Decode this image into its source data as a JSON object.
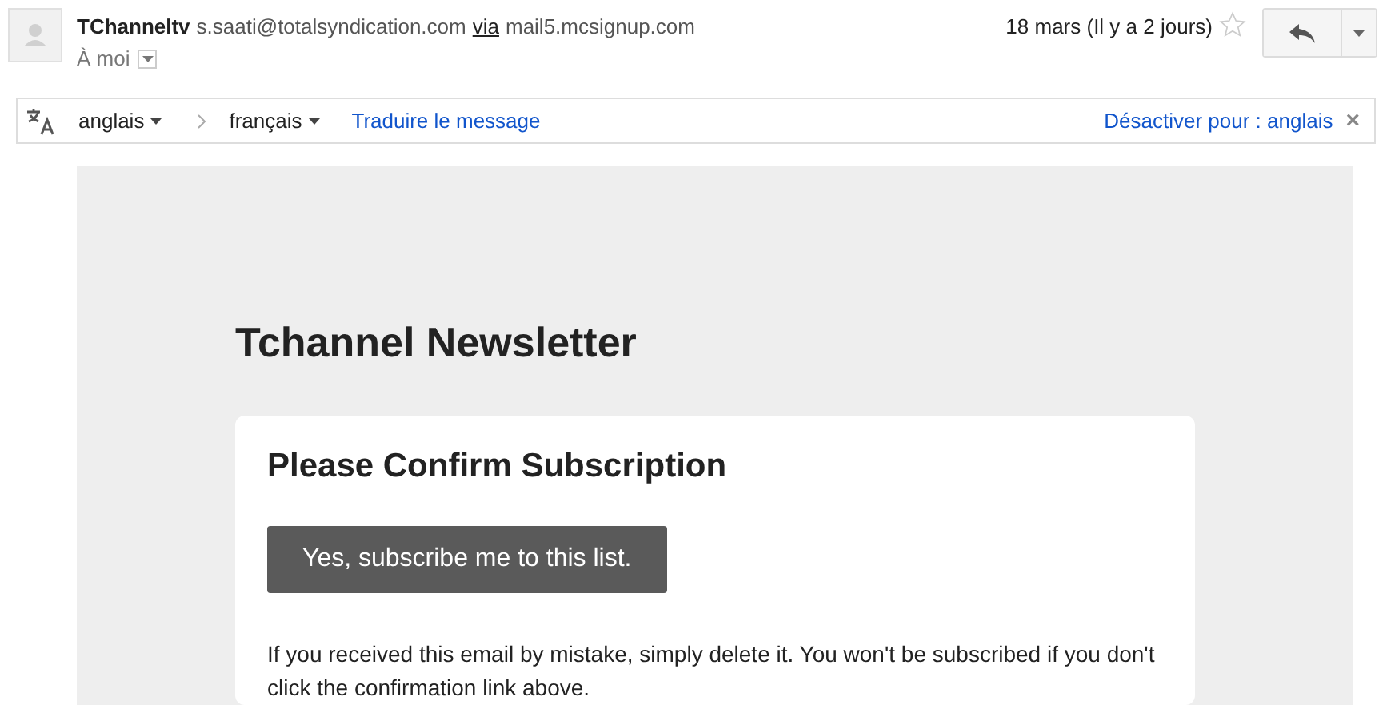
{
  "header": {
    "sender_name": "TChanneltv",
    "sender_email": "s.saati@totalsyndication.com",
    "via_label": "via",
    "via_domain": "mail5.mcsignup.com",
    "recipient": "À moi",
    "date": "18 mars (Il y a 2 jours)",
    "starred": false
  },
  "translate_bar": {
    "source_language": "anglais",
    "target_language": "français",
    "translate_link": "Traduire le message",
    "disable_link": "Désactiver pour : anglais",
    "close": "×"
  },
  "email": {
    "title": "Tchannel Newsletter",
    "heading": "Please Confirm Subscription",
    "button": "Yes, subscribe me to this list.",
    "note": "If you received this email by mistake, simply delete it. You won't be subscribed if you don't click the confirmation link above."
  }
}
